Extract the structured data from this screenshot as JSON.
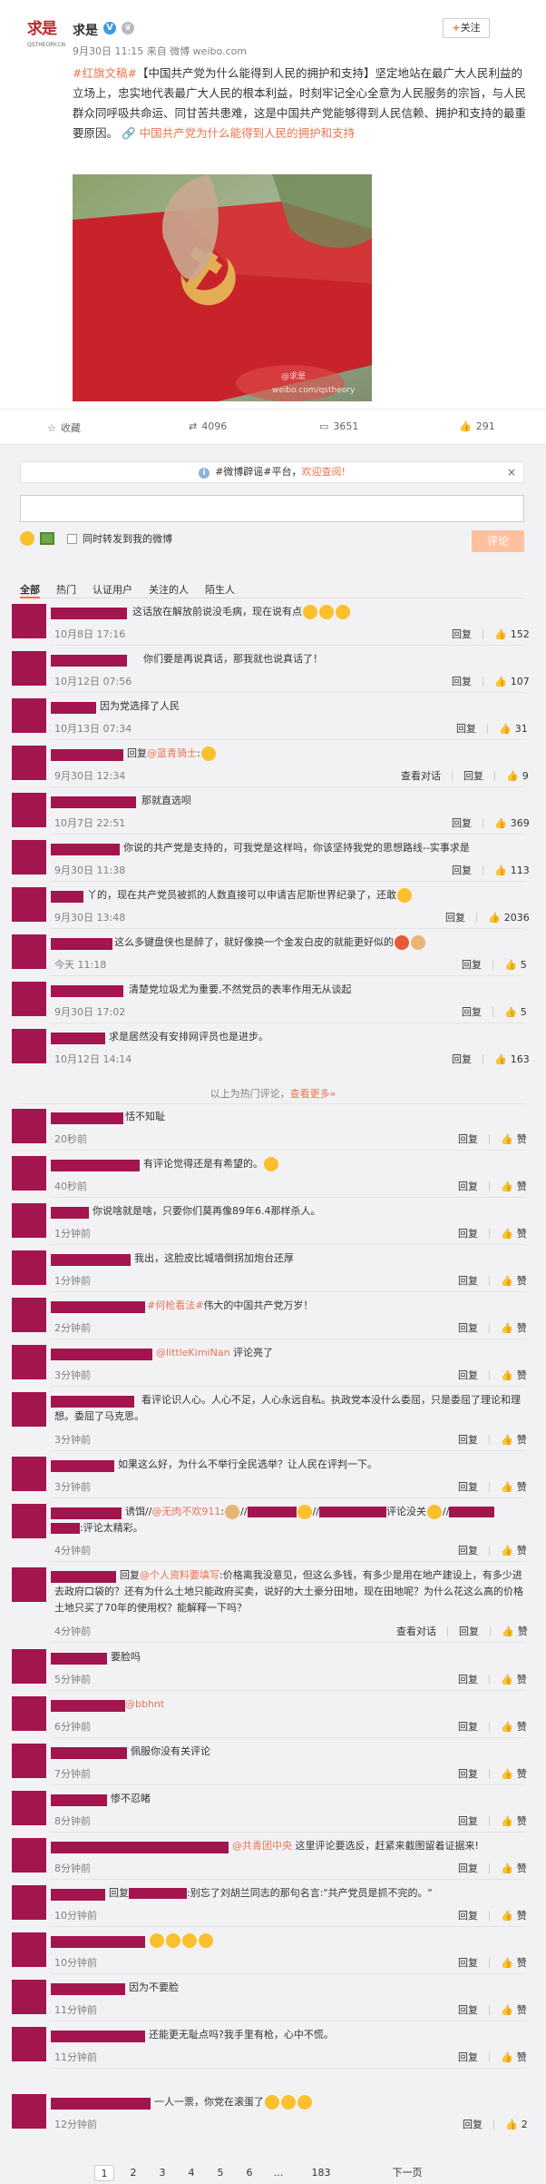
{
  "post": {
    "username": "求是",
    "verified_mark": "V",
    "meta": "9月30日 11:15 来自 微博 weibo.com",
    "follow_label": "关注",
    "logo_text": "求是",
    "logo_sub": "QSTHEORY.CN",
    "topic_tag": "#红旗文稿#",
    "body": "【中国共产党为什么能得到人民的拥护和支持】坚定地站在最广大人民利益的立场上，忠实地代表最广大人民的根本利益，时刻牢记全心全意为人民服务的宗旨，与人民群众同呼吸共命运、同甘苦共患难，这是中国共产党能够得到人民信赖、拥护和支持的最重要原因。",
    "link_text": "中国共产党为什么能得到人民的拥护和支持",
    "watermark": "@求是\nweibo.com/qstheory"
  },
  "actions": {
    "favorite": "收藏",
    "repost": "4096",
    "comment": "3651",
    "like": "291"
  },
  "notice": {
    "prefix": "#微博辟谣#平台，",
    "highlight": "欢迎查阅!",
    "close": "×"
  },
  "composer": {
    "checkbox_label": "同时转发到我的微博",
    "submit": "评论"
  },
  "tabs": [
    "全部",
    "热门",
    "认证用户",
    "关注的人",
    "陌生人"
  ],
  "hot_note": {
    "text": "以上为热门评论，",
    "link": "查看更多»"
  },
  "reply": "回复",
  "view_conv": "查看对话",
  "like_word": "赞",
  "comments": [
    {
      "text": "这话放在解放前说没毛病，现在说有点",
      "time": "10月8日 17:16",
      "likes": "152"
    },
    {
      "text": "你们要是再说真话，那我就也说真话了！",
      "time": "10月12日 07:56",
      "likes": "107"
    },
    {
      "text": "因为党选择了人民",
      "time": "10月13日 07:34",
      "likes": "31"
    },
    {
      "text": "回复",
      "at": "@蓝青骑士",
      "time": "9月30日 12:34",
      "likes": "9"
    },
    {
      "text": "那就直选呗",
      "time": "10月7日 22:51",
      "likes": "369"
    },
    {
      "text": "你说的共产党是支持的，可我党是这样吗，你该坚持我党的思想路线--实事求是",
      "time": "9月30日 11:38",
      "likes": "113"
    },
    {
      "text": "丫的，现在共产党员被抓的人数直接可以申请吉尼斯世界纪录了，还敢",
      "time": "9月30日 13:48",
      "likes": "2036"
    },
    {
      "text": "这么多键盘侠也是醉了，就好像换一个金发白皮的就能更好似的",
      "time": "今天 11:18",
      "likes": "5"
    },
    {
      "text": "清楚党垃圾尤为重要,不然党员的表率作用无从谈起",
      "time": "9月30日 17:02",
      "likes": "5"
    },
    {
      "text": "求是居然没有安排网评员也是进步。",
      "time": "10月12日 14:14",
      "likes": "163"
    },
    {
      "text": "恬不知耻",
      "time": "20秒前"
    },
    {
      "text": "有评论觉得还是有希望的。",
      "time": "40秒前"
    },
    {
      "text": "你说啥就是啥，只要你们莫再像89年6.4那样杀人。",
      "time": "1分钟前"
    },
    {
      "text": "我出，这脸皮比城墙倒拐加炮台还厚",
      "time": "1分钟前"
    },
    {
      "text": "伟大的中国共产党万岁！",
      "at": "#何枪看法#",
      "time": "2分钟前"
    },
    {
      "text": "评论亮了",
      "at": "@littleKimiNan",
      "time": "3分钟前"
    },
    {
      "text": "看评论识人心。人心不足，人心永远自私。执政党本没什么委屈，只是委屈了理论和理想。委屈了马克思。",
      "time": "3分钟前"
    },
    {
      "text": "如果这么好，为什么不举行全民选举？让人民在评判一下。",
      "time": "3分钟前"
    },
    {
      "text": "评论太精彩。",
      "prefix": "诱饵//",
      "at": "@无肉不欢911",
      "mid": "评论没关",
      "time": "4分钟前"
    },
    {
      "text": "价格离我没意见，但这么多钱，有多少是用在地产建设上，有多少进去政府口袋的？还有为什么土地只能政府买卖，说好的大土豪分田地，现在田地呢？为什么花这么高的价格土地只买了70年的使用权？能解释一下吗？",
      "prefix": "回复",
      "at": "@个人资料要填写",
      "time": "4分钟前"
    },
    {
      "text": "要脸吗",
      "time": "5分钟前"
    },
    {
      "text": "",
      "at": "@bbhnt",
      "time": "6分钟前"
    },
    {
      "text": "佩服你没有关评论",
      "time": "7分钟前"
    },
    {
      "text": "惨不忍睹",
      "time": "8分钟前"
    },
    {
      "text": "这里评论要选反，赶紧来截图留着证据来!",
      "at": "@共青团中央",
      "time": "8分钟前"
    },
    {
      "text": "别忘了刘胡兰同志的那句名言:\"共产党员是抓不完的。\"",
      "prefix": "回复",
      "time": "10分钟前"
    },
    {
      "text": "",
      "time": "10分钟前"
    },
    {
      "text": "因为不要脸",
      "time": "11分钟前"
    },
    {
      "text": "还能更无耻点吗?我手里有枪，心中不慌。",
      "time": "11分钟前"
    },
    {
      "text": "一人一票，你党在滚蛋了",
      "time": "12分钟前",
      "likes": "2"
    }
  ],
  "pager": {
    "pages": [
      "1",
      "2",
      "3",
      "4",
      "5",
      "6",
      "...",
      "183"
    ],
    "next": "下一页"
  },
  "colors": {
    "accent": "#eb7350",
    "avatar_redaction": "#a3154f",
    "verified": "#3b9be5"
  }
}
